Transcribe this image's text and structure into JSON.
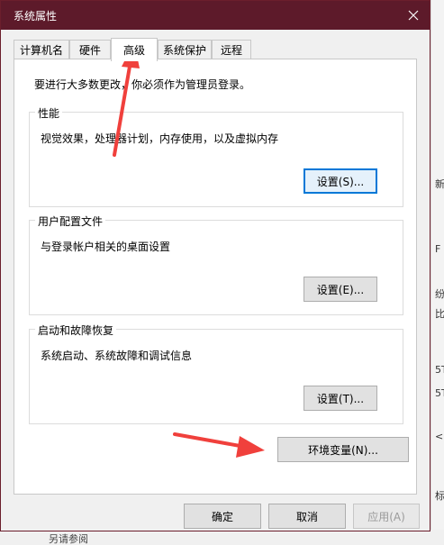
{
  "window": {
    "title": "系统属性"
  },
  "tabs": [
    {
      "label": "计算机名",
      "active": false
    },
    {
      "label": "硬件",
      "active": false
    },
    {
      "label": "高级",
      "active": true
    },
    {
      "label": "系统保护",
      "active": false
    },
    {
      "label": "远程",
      "active": false
    }
  ],
  "advanced": {
    "notice": "要进行大多数更改，你必须作为管理员登录。",
    "performance": {
      "legend": "性能",
      "description": "视觉效果，处理器计划，内存使用，以及虚拟内存",
      "button": "设置(S)..."
    },
    "user_profiles": {
      "legend": "用户配置文件",
      "description": "与登录帐户相关的桌面设置",
      "button": "设置(E)..."
    },
    "startup_recovery": {
      "legend": "启动和故障恢复",
      "description": "系统启动、系统故障和调试信息",
      "button": "设置(T)..."
    },
    "env_button": "环境变量(N)..."
  },
  "footer": {
    "ok": "确定",
    "cancel": "取消",
    "apply": "应用(A)"
  },
  "background": {
    "right_fragments": [
      "新",
      "F",
      "纷",
      "比",
      "5T",
      "5T",
      "<",
      "标"
    ],
    "bottom_fragment": "另请参阅"
  },
  "colors": {
    "titlebar": "#5d1a2a",
    "focus_border": "#0078d7",
    "annotation_arrow": "#f0403c"
  }
}
